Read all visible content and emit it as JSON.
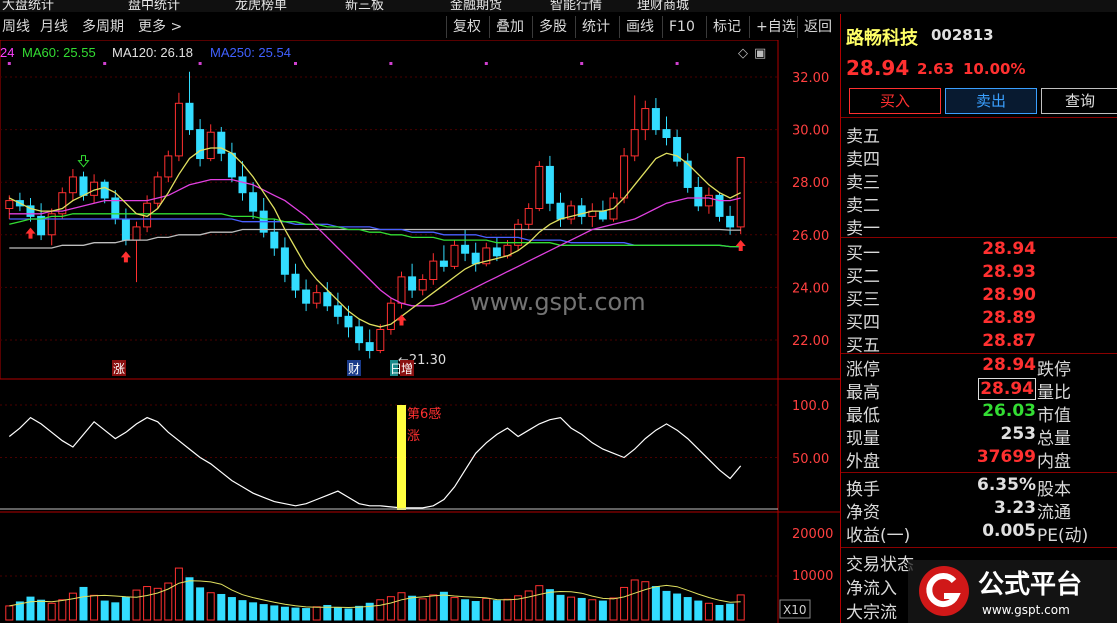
{
  "topbar": {
    "items": [
      "大盘统计",
      "盘中统计",
      "龙虎榜单",
      "新三板",
      "金融期货",
      "智能行情",
      "理财商城"
    ]
  },
  "toolbar": {
    "left": [
      "周线",
      "月线",
      "多周期",
      "更多 >"
    ],
    "right": [
      "复权",
      "叠加",
      "多股",
      "统计",
      "画线",
      "F10",
      "标记",
      "+自选",
      "返回"
    ]
  },
  "ma_legend": [
    {
      "label": "24",
      "color": "#ff40ff"
    },
    {
      "label": "MA60: 25.55",
      "color": "#33dd33"
    },
    {
      "label": "MA120: 26.18",
      "color": "#e0e0e0"
    },
    {
      "label": "MA250: 25.54",
      "color": "#4060ff"
    }
  ],
  "price_axis": [
    "32.00",
    "30.00",
    "28.00",
    "26.00",
    "24.00",
    "22.00"
  ],
  "ind_axis": [
    "100.0",
    "50.00"
  ],
  "vol_axis": [
    "20000",
    "10000"
  ],
  "vol_unit": "X10",
  "annotations": {
    "low": "←21.30",
    "zhang1": "涨",
    "cai": "财",
    "ri": "日",
    "zeng": "增",
    "ind_text1": "第6感",
    "ind_text2": "涨"
  },
  "watermark_url": "www.gspt.com",
  "stock": {
    "name": "路畅科技",
    "code": "002813",
    "price": "28.94",
    "change": "2.63",
    "pct": "10.00%"
  },
  "buttons": {
    "buy": "买入",
    "sell": "卖出",
    "query": "查询"
  },
  "sell_levels": [
    "卖五",
    "卖四",
    "卖三",
    "卖二",
    "卖一"
  ],
  "buy_levels": [
    {
      "label": "买一",
      "price": "28.94"
    },
    {
      "label": "买二",
      "price": "28.93"
    },
    {
      "label": "买三",
      "price": "28.90"
    },
    {
      "label": "买四",
      "price": "28.89"
    },
    {
      "label": "买五",
      "price": "28.87"
    }
  ],
  "stats": [
    {
      "l": "涨停",
      "v": "28.94",
      "c": "#ff3030",
      "r": "跌停",
      "box": false
    },
    {
      "l": "最高",
      "v": "28.94",
      "c": "#ff3030",
      "r": "量比",
      "box": true
    },
    {
      "l": "最低",
      "v": "26.03",
      "c": "#33dd33",
      "r": "市值",
      "box": false
    },
    {
      "l": "现量",
      "v": "253",
      "c": "#e0e0e0",
      "r": "总量",
      "box": false
    },
    {
      "l": "外盘",
      "v": "37699",
      "c": "#ff3030",
      "r": "内盘",
      "box": false
    }
  ],
  "stats2": [
    {
      "l": "换手",
      "v": "6.35%",
      "r": "股本"
    },
    {
      "l": "净资",
      "v": "3.23",
      "r": "流通"
    },
    {
      "l": "收益(一)",
      "v": "0.005",
      "r": "PE(动)"
    }
  ],
  "stats3": [
    "交易状态",
    "净流入",
    "大宗流"
  ],
  "logo": {
    "text": "公式平台",
    "url": "www.gspt.com"
  },
  "colors": {
    "up": "#ff3030",
    "down": "#33ddff",
    "bg": "#000000",
    "grid": "#b00000"
  },
  "chart_data": {
    "type": "candlestick",
    "ylim": [
      21,
      33
    ],
    "ohlc": [
      [
        27.0,
        27.5,
        26.6,
        27.3
      ],
      [
        27.3,
        27.6,
        26.9,
        27.1
      ],
      [
        27.1,
        27.4,
        26.5,
        26.7
      ],
      [
        26.7,
        27.2,
        25.8,
        26.0
      ],
      [
        26.0,
        27.0,
        25.6,
        26.8
      ],
      [
        26.8,
        27.8,
        26.6,
        27.6
      ],
      [
        27.6,
        28.5,
        27.3,
        28.2
      ],
      [
        28.2,
        28.4,
        27.3,
        27.5
      ],
      [
        27.5,
        28.3,
        27.2,
        28.0
      ],
      [
        28.0,
        28.1,
        27.2,
        27.4
      ],
      [
        27.4,
        27.7,
        26.4,
        26.6
      ],
      [
        26.6,
        27.0,
        25.6,
        25.8
      ],
      [
        25.8,
        26.5,
        24.2,
        26.3
      ],
      [
        26.3,
        27.5,
        26.1,
        27.2
      ],
      [
        27.2,
        28.4,
        27.0,
        28.2
      ],
      [
        28.2,
        29.2,
        28.0,
        29.0
      ],
      [
        29.0,
        31.4,
        28.8,
        31.0
      ],
      [
        31.0,
        32.2,
        29.8,
        30.0
      ],
      [
        30.0,
        30.4,
        28.6,
        28.9
      ],
      [
        28.9,
        30.2,
        28.8,
        29.9
      ],
      [
        29.9,
        30.1,
        28.8,
        29.1
      ],
      [
        29.1,
        29.5,
        28.0,
        28.2
      ],
      [
        28.2,
        28.8,
        27.3,
        27.6
      ],
      [
        27.6,
        28.0,
        26.6,
        26.9
      ],
      [
        26.9,
        27.4,
        25.9,
        26.1
      ],
      [
        26.1,
        26.6,
        25.2,
        25.5
      ],
      [
        25.5,
        25.9,
        24.2,
        24.5
      ],
      [
        24.5,
        24.9,
        23.6,
        23.9
      ],
      [
        23.9,
        24.3,
        23.1,
        23.4
      ],
      [
        23.4,
        24.1,
        23.2,
        23.8
      ],
      [
        23.8,
        24.2,
        23.1,
        23.3
      ],
      [
        23.3,
        23.8,
        22.6,
        22.9
      ],
      [
        22.9,
        23.3,
        22.1,
        22.5
      ],
      [
        22.5,
        22.8,
        21.6,
        21.9
      ],
      [
        21.9,
        22.4,
        21.3,
        21.6
      ],
      [
        21.6,
        22.6,
        21.5,
        22.4
      ],
      [
        22.4,
        23.6,
        22.2,
        23.4
      ],
      [
        23.4,
        24.6,
        23.2,
        24.4
      ],
      [
        24.4,
        24.9,
        23.6,
        23.9
      ],
      [
        23.9,
        24.5,
        23.7,
        24.3
      ],
      [
        24.3,
        25.3,
        24.1,
        25.0
      ],
      [
        25.0,
        25.6,
        24.6,
        24.8
      ],
      [
        24.8,
        25.8,
        24.7,
        25.6
      ],
      [
        25.6,
        26.2,
        25.0,
        25.3
      ],
      [
        25.3,
        25.7,
        24.6,
        24.9
      ],
      [
        24.9,
        25.7,
        24.8,
        25.5
      ],
      [
        25.5,
        25.9,
        25.0,
        25.2
      ],
      [
        25.2,
        25.8,
        25.1,
        25.6
      ],
      [
        25.6,
        26.6,
        25.4,
        26.4
      ],
      [
        26.4,
        27.2,
        26.2,
        27.0
      ],
      [
        27.0,
        28.8,
        26.9,
        28.6
      ],
      [
        28.6,
        29.0,
        26.9,
        27.2
      ],
      [
        27.2,
        27.6,
        26.3,
        26.6
      ],
      [
        26.6,
        27.3,
        26.4,
        27.1
      ],
      [
        27.1,
        27.4,
        26.4,
        26.7
      ],
      [
        26.7,
        27.2,
        26.3,
        26.9
      ],
      [
        26.9,
        27.3,
        26.5,
        26.6
      ],
      [
        26.6,
        27.6,
        26.5,
        27.4
      ],
      [
        27.4,
        29.3,
        27.2,
        29.0
      ],
      [
        29.0,
        31.3,
        28.8,
        30.0
      ],
      [
        30.0,
        31.1,
        29.6,
        30.8
      ],
      [
        30.8,
        31.2,
        29.8,
        30.0
      ],
      [
        30.0,
        30.5,
        29.4,
        29.7
      ],
      [
        29.7,
        30.0,
        28.6,
        28.8
      ],
      [
        28.8,
        29.1,
        27.6,
        27.8
      ],
      [
        27.8,
        28.2,
        26.9,
        27.1
      ],
      [
        27.1,
        27.8,
        26.8,
        27.5
      ],
      [
        27.5,
        27.6,
        26.5,
        26.7
      ],
      [
        26.7,
        27.1,
        26.0,
        26.3
      ],
      [
        26.3,
        28.94,
        26.03,
        28.94
      ]
    ],
    "ma_short": [
      27.4,
      27.2,
      27.0,
      26.9,
      26.9,
      27.0,
      27.3,
      27.5,
      27.7,
      27.8,
      27.6,
      27.2,
      26.8,
      26.7,
      27.0,
      27.6,
      28.3,
      28.9,
      29.2,
      29.3,
      29.3,
      29.1,
      28.7,
      28.2,
      27.6,
      27.0,
      26.2,
      25.5,
      24.8,
      24.3,
      23.9,
      23.5,
      23.1,
      22.8,
      22.6,
      22.5,
      22.6,
      22.9,
      23.2,
      23.5,
      23.8,
      24.1,
      24.4,
      24.7,
      24.9,
      25.0,
      25.1,
      25.2,
      25.4,
      25.7,
      26.1,
      26.4,
      26.6,
      26.7,
      26.8,
      26.9,
      26.9,
      27.0,
      27.4,
      27.9,
      28.4,
      28.9,
      29.1,
      29.0,
      28.7,
      28.3,
      27.9,
      27.6,
      27.4,
      27.6
    ],
    "ma_mid": [
      26.8,
      26.8,
      26.8,
      26.8,
      26.9,
      26.9,
      27.0,
      27.1,
      27.2,
      27.3,
      27.3,
      27.3,
      27.3,
      27.3,
      27.4,
      27.5,
      27.7,
      27.9,
      28.0,
      28.1,
      28.1,
      28.1,
      28.0,
      27.9,
      27.7,
      27.5,
      27.3,
      27.0,
      26.7,
      26.3,
      25.9,
      25.5,
      25.1,
      24.7,
      24.3,
      23.9,
      23.6,
      23.4,
      23.3,
      23.3,
      23.3,
      23.4,
      23.6,
      23.8,
      24.0,
      24.2,
      24.4,
      24.6,
      24.8,
      25.0,
      25.2,
      25.4,
      25.6,
      25.8,
      26.0,
      26.2,
      26.3,
      26.4,
      26.5,
      26.6,
      26.8,
      27.0,
      27.2,
      27.3,
      27.4,
      27.4,
      27.4,
      27.3,
      27.3,
      27.4
    ],
    "ma_green": [
      26.4,
      26.5,
      26.6,
      26.6,
      26.7,
      26.7,
      26.8,
      26.8,
      26.8,
      26.8,
      26.8,
      26.8,
      26.8,
      26.8,
      26.8,
      26.8,
      26.8,
      26.8,
      26.8,
      26.8,
      26.8,
      26.7,
      26.7,
      26.7,
      26.6,
      26.6,
      26.5,
      26.5,
      26.4,
      26.4,
      26.3,
      26.3,
      26.2,
      26.2,
      26.1,
      26.1,
      26.0,
      26.0,
      25.9,
      25.9,
      25.9,
      25.8,
      25.8,
      25.8,
      25.8,
      25.8,
      25.7,
      25.7,
      25.7,
      25.7,
      25.7,
      25.7,
      25.6,
      25.6,
      25.6,
      25.6,
      25.6,
      25.6,
      25.6,
      25.6,
      25.6,
      25.6,
      25.6,
      25.6,
      25.6,
      25.6,
      25.6,
      25.6,
      25.55,
      25.55
    ],
    "ma_blue": [
      26.6,
      26.6,
      26.6,
      26.6,
      26.6,
      26.6,
      26.6,
      26.6,
      26.6,
      26.6,
      26.6,
      26.6,
      26.6,
      26.6,
      26.6,
      26.6,
      26.6,
      26.6,
      26.6,
      26.6,
      26.6,
      26.6,
      26.5,
      26.5,
      26.5,
      26.5,
      26.5,
      26.4,
      26.4,
      26.4,
      26.4,
      26.3,
      26.3,
      26.3,
      26.3,
      26.2,
      26.2,
      26.2,
      26.1,
      26.1,
      26.1,
      26.0,
      26.0,
      26.0,
      26.0,
      25.9,
      25.9,
      25.9,
      25.9,
      25.8,
      25.8,
      25.8,
      25.8,
      25.7,
      25.7,
      25.7,
      25.7,
      25.7,
      25.7,
      25.6,
      25.6,
      25.6,
      25.6,
      25.6,
      25.6,
      25.6,
      25.6,
      25.6,
      25.55,
      25.54
    ],
    "ma_white": [
      25.5,
      25.5,
      25.5,
      25.5,
      25.5,
      25.6,
      25.6,
      25.6,
      25.7,
      25.7,
      25.7,
      25.8,
      25.8,
      25.8,
      25.9,
      25.9,
      26.0,
      26.0,
      26.0,
      26.1,
      26.1,
      26.1,
      26.2,
      26.2,
      26.2,
      26.2,
      26.2,
      26.2,
      26.2,
      26.2,
      26.2,
      26.2,
      26.2,
      26.2,
      26.2,
      26.2,
      26.2,
      26.2,
      26.2,
      26.2,
      26.2,
      26.2,
      26.2,
      26.2,
      26.2,
      26.2,
      26.2,
      26.2,
      26.2,
      26.2,
      26.2,
      26.2,
      26.2,
      26.2,
      26.2,
      26.2,
      26.2,
      26.2,
      26.2,
      26.2,
      26.2,
      26.2,
      26.2,
      26.2,
      26.2,
      26.2,
      26.2,
      26.2,
      26.18,
      26.18
    ],
    "indicator": [
      70,
      78,
      88,
      82,
      74,
      66,
      60,
      72,
      84,
      76,
      68,
      74,
      82,
      88,
      84,
      74,
      66,
      58,
      50,
      44,
      36,
      28,
      22,
      16,
      12,
      8,
      6,
      4,
      6,
      10,
      14,
      18,
      12,
      6,
      4,
      4,
      3,
      2,
      2,
      2,
      4,
      10,
      22,
      38,
      54,
      64,
      72,
      78,
      70,
      76,
      82,
      86,
      88,
      78,
      72,
      64,
      58,
      54,
      50,
      58,
      68,
      76,
      82,
      76,
      68,
      58,
      48,
      38,
      30,
      42
    ],
    "volume": [
      3200,
      4100,
      5200,
      4500,
      3800,
      4600,
      6100,
      7400,
      5600,
      4300,
      3900,
      5200,
      6800,
      7600,
      7200,
      8400,
      11800,
      9600,
      7300,
      6200,
      5800,
      5100,
      4400,
      3900,
      3500,
      3200,
      2900,
      2700,
      2600,
      3000,
      3300,
      2800,
      2500,
      3100,
      3800,
      4600,
      5300,
      6200,
      5400,
      4800,
      5700,
      6300,
      5100,
      4600,
      4200,
      4900,
      4400,
      4700,
      5500,
      6600,
      7800,
      6900,
      5600,
      5200,
      4900,
      4600,
      4300,
      5000,
      7400,
      9100,
      8700,
      7600,
      6500,
      5900,
      5100,
      4300,
      3800,
      3300,
      3600,
      5700
    ]
  }
}
